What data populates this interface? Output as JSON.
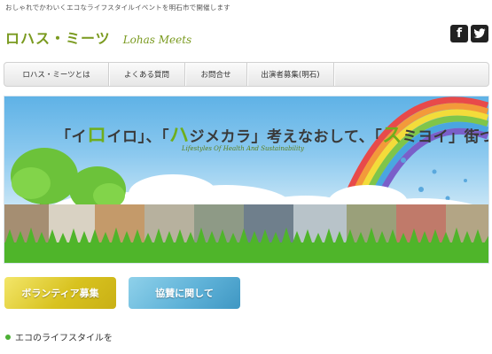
{
  "header": {
    "tagline": "おしゃれでかわいくエコなライフスタイルイベントを明石市で開催します",
    "logo_jp": "ロハス・ミーツ",
    "logo_en": "Lohas Meets",
    "social": [
      {
        "label": "f",
        "icon": "facebook-icon"
      },
      {
        "label": "t",
        "icon": "twitter-icon"
      }
    ]
  },
  "nav": {
    "items": [
      {
        "label": "ロハス・ミーツとは"
      },
      {
        "label": "よくある質問"
      },
      {
        "label": "お問合せ"
      },
      {
        "label": "出演者募集(明石)"
      }
    ]
  },
  "hero": {
    "headline_parts": [
      "「イ",
      "ロ",
      "イロ」、「",
      "ハ",
      "ジメカラ」考えなおして、「",
      "ス",
      "ミヨイ」街づくり"
    ],
    "subtitle": "Lifestyles Of Health And Sustainability"
  },
  "banners": [
    {
      "label": "ボランティア募集"
    },
    {
      "label": "協賛に関して"
    }
  ],
  "section_heading": "エコのライフスタイルを",
  "colors": {
    "accent_green": "#7a9a1f",
    "nav_bg": "#eeeeee",
    "sky_blue": "#8cc9ef"
  }
}
